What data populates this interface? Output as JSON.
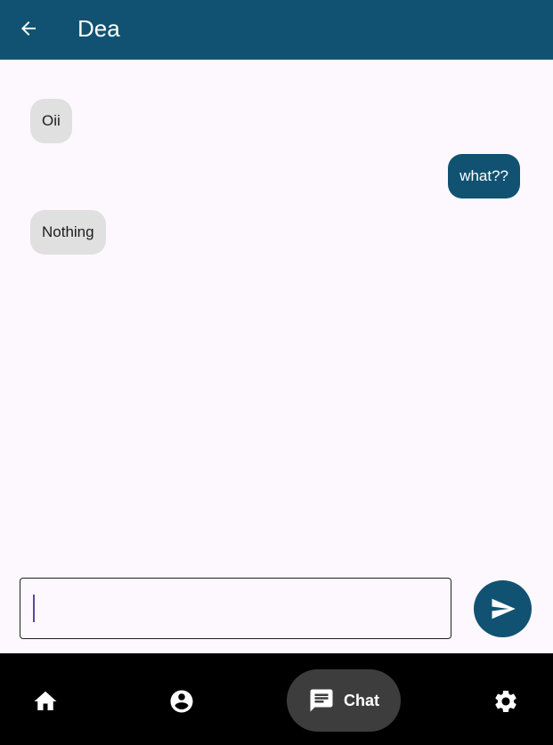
{
  "header": {
    "title": "Dea",
    "back_icon": "arrow-back-icon"
  },
  "messages": [
    {
      "text": "Oii",
      "direction": "incoming"
    },
    {
      "text": "what??",
      "direction": "outgoing"
    },
    {
      "text": "Nothing",
      "direction": "incoming"
    }
  ],
  "composer": {
    "value": "",
    "send_icon": "send-icon"
  },
  "nav": {
    "items": [
      {
        "icon": "home-icon"
      },
      {
        "icon": "account-circle-icon"
      },
      {
        "icon": "chat-icon",
        "label": "Chat",
        "active": true
      },
      {
        "icon": "settings-gear-icon"
      }
    ]
  },
  "colors": {
    "primary": "#115272",
    "background": "#fdf8fd",
    "incoming_bubble": "#e0e0e0",
    "nav_background": "#000000",
    "nav_active_pill": "#3d3d3d"
  }
}
